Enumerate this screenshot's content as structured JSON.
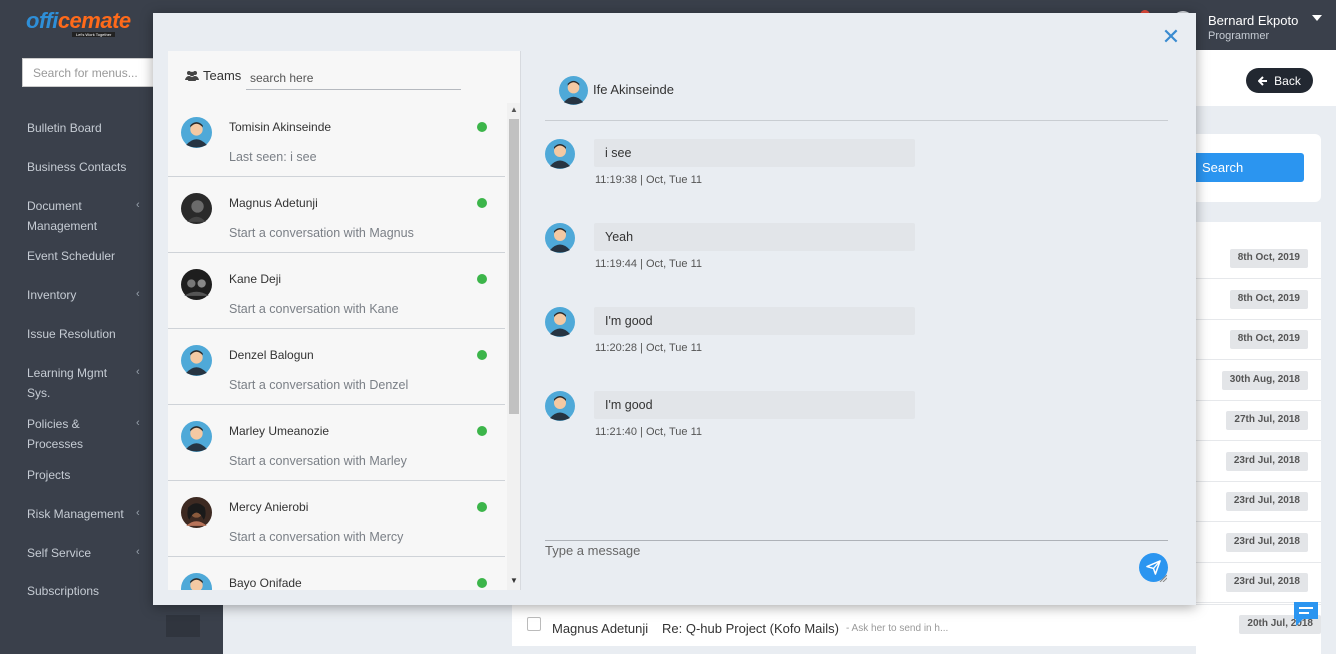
{
  "app": {
    "logo_text": "officemate",
    "logo_tagline": "Let's Work Together"
  },
  "sidebar": {
    "search_placeholder": "Search for menus...",
    "items": [
      {
        "label": "Bulletin Board"
      },
      {
        "label": "Business Contacts"
      },
      {
        "label": "Document Management"
      },
      {
        "label": "Event Scheduler"
      },
      {
        "label": "Inventory"
      },
      {
        "label": "Issue Resolution"
      },
      {
        "label": "Learning Mgmt Sys."
      },
      {
        "label": "Policies & Processes"
      },
      {
        "label": "Projects"
      },
      {
        "label": "Risk Management"
      },
      {
        "label": "Self Service"
      },
      {
        "label": "Subscriptions"
      }
    ]
  },
  "header": {
    "user_name": "Bernard Ekpoto",
    "user_role": "Programmer"
  },
  "page": {
    "back_label": "Back",
    "search_label": "Search",
    "dates": [
      "8th Oct, 2019",
      "8th Oct, 2019",
      "8th Oct, 2019",
      "30th Aug, 2018",
      "27th Jul, 2018",
      "23rd Jul, 2018",
      "23rd Jul, 2018",
      "23rd Jul, 2018",
      "23rd Jul, 2018"
    ],
    "mail_row": {
      "from": "Magnus Adetunji",
      "subject": "Re: Q-hub Project (Kofo Mails)",
      "preview": "- Ask her to send in h...",
      "date": "20th Jul, 2018"
    }
  },
  "chat_modal": {
    "close_icon": "close-icon",
    "teams_label": "Teams",
    "search_placeholder": "search here",
    "contacts": [
      {
        "name": "Tomisin Akinseinde",
        "subtitle": "Last seen: i see"
      },
      {
        "name": "Magnus Adetunji",
        "subtitle": "Start a conversation with Magnus"
      },
      {
        "name": "Kane Deji",
        "subtitle": "Start a conversation with Kane"
      },
      {
        "name": "Denzel Balogun",
        "subtitle": "Start a conversation with Denzel"
      },
      {
        "name": "Marley Umeanozie",
        "subtitle": "Start a conversation with Marley"
      },
      {
        "name": "Mercy Anierobi",
        "subtitle": "Start a conversation with Mercy"
      },
      {
        "name": "Bayo Onifade",
        "subtitle": ""
      }
    ],
    "active_chat": {
      "name": "Ife Akinseinde",
      "messages": [
        {
          "text": "i see",
          "time": "11:19:38 | Oct, Tue 11"
        },
        {
          "text": "Yeah",
          "time": "11:19:44 | Oct, Tue 11"
        },
        {
          "text": "I'm good",
          "time": "11:20:28 | Oct, Tue 11"
        },
        {
          "text": "I'm good",
          "time": "11:21:40 | Oct, Tue 11"
        }
      ],
      "input_placeholder": "Type a message"
    }
  },
  "colors": {
    "sidebar_bg": "#3a404b",
    "accent": "#2b95f0",
    "online": "#3cb54a",
    "close": "#3a8bd0"
  }
}
